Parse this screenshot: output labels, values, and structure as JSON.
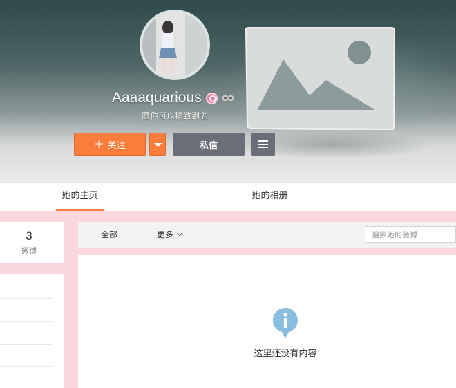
{
  "profile": {
    "username": "Aaaaquarious",
    "bio": "愿你可以精致到老"
  },
  "actions": {
    "follow_label": "关注",
    "message_label": "私信"
  },
  "tabs": [
    {
      "label": "她的主页",
      "active": true
    },
    {
      "label": "她的相册",
      "active": false
    }
  ],
  "stats": {
    "count": "3",
    "label": "微博"
  },
  "filters": {
    "all_label": "全部",
    "more_label": "更多",
    "search_placeholder": "搜索她的微博"
  },
  "empty_state": {
    "message": "这里还没有内容"
  },
  "colors": {
    "accent": "#fa7d3c",
    "page_background": "#f9d7dd",
    "info_icon": "#88bde0"
  }
}
